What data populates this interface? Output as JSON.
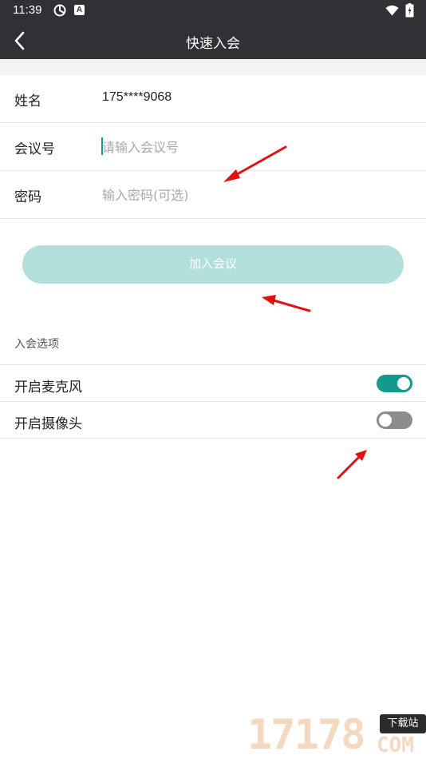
{
  "status_bar": {
    "time": "11:39",
    "notification_icon": "A"
  },
  "header": {
    "title": "快速入会",
    "back_icon": "chevron-left-icon"
  },
  "form": {
    "name_label": "姓名",
    "name_value": "175****9068",
    "meeting_id_label": "会议号",
    "meeting_id_placeholder": "请输入会议号",
    "password_label": "密码",
    "password_placeholder": "输入密码(可选)"
  },
  "join_button_label": "加入会议",
  "options": {
    "section_title": "入会选项",
    "items": [
      {
        "label": "开启麦克风",
        "enabled": true
      },
      {
        "label": "开启摄像头",
        "enabled": false
      }
    ]
  },
  "watermark": {
    "digits": "17178",
    "badge": "下载站",
    "suffix": "COM"
  },
  "colors": {
    "bar": "#2f3135",
    "accent": "#139a8d",
    "button_disabled": "#b2dfdc",
    "switch_off": "#8d8d8d",
    "annotation_arrow": "#e01010"
  }
}
